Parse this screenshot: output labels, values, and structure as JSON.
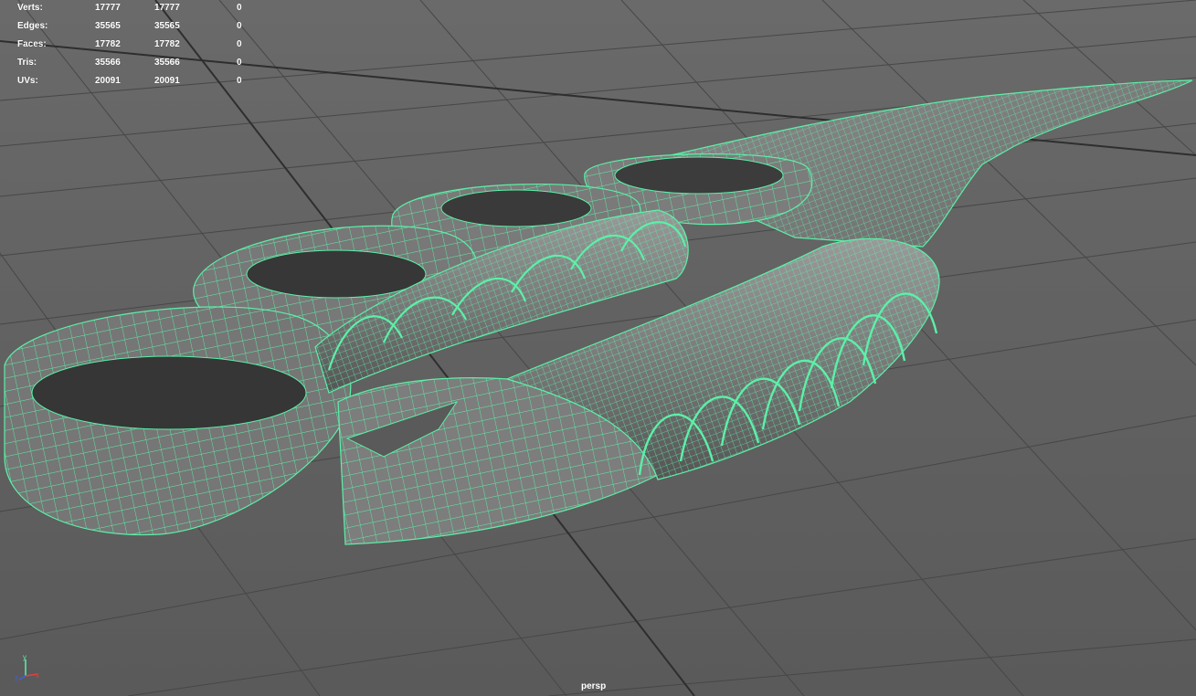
{
  "viewport": {
    "camera": "persp",
    "wire_color": "#5cf0a8",
    "floor_color": "#5e5e5e",
    "grid_color": "#474747"
  },
  "hud": {
    "rows": [
      {
        "label": "Verts:",
        "v1": "17777",
        "v2": "17777",
        "v3": "0"
      },
      {
        "label": "Edges:",
        "v1": "35565",
        "v2": "35565",
        "v3": "0"
      },
      {
        "label": "Faces:",
        "v1": "17782",
        "v2": "17782",
        "v3": "0"
      },
      {
        "label": "Tris:",
        "v1": "35566",
        "v2": "35566",
        "v3": "0"
      },
      {
        "label": "UVs:",
        "v1": "20091",
        "v2": "20091",
        "v3": "0"
      }
    ]
  },
  "axis_gizmo": {
    "x": "x",
    "y": "y",
    "z": "z"
  }
}
